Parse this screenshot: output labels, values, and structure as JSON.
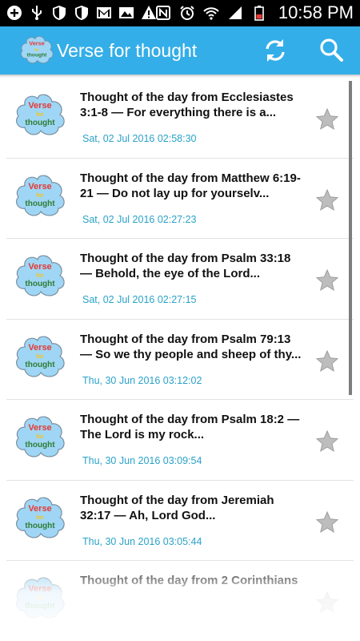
{
  "status_bar": {
    "time": "10:58 PM",
    "left_icons": [
      "add-icon",
      "usb-icon",
      "shield-icon",
      "shield-icon",
      "gmail-icon",
      "image-icon",
      "warning-icon"
    ],
    "right_icons": [
      "nfc-icon",
      "alarm-icon",
      "wifi-icon",
      "signal-icon",
      "battery-icon"
    ]
  },
  "app_bar": {
    "title": "Verse for thought",
    "logo_text": [
      "Verse",
      "for",
      "thought"
    ]
  },
  "items": [
    {
      "title": "Thought of the day from Ecclesiastes 3:1-8 — For everything there is a...",
      "date": "Sat, 02 Jul 2016 02:58:30"
    },
    {
      "title": "Thought of the day from Matthew 6:19-21 — Do not lay up for yourselv...",
      "date": "Sat, 02 Jul 2016 02:27:23"
    },
    {
      "title": "Thought of the day from Psalm 33:18 — Behold, the eye of the Lord...",
      "date": "Sat, 02 Jul 2016 02:27:15"
    },
    {
      "title": "Thought of the day from Psalm 79:13 — So we thy people and sheep of thy...",
      "date": "Thu, 30 Jun 2016 03:12:02"
    },
    {
      "title": "Thought of the day from Psalm 18:2 — The Lord is my rock...",
      "date": "Thu, 30 Jun 2016 03:09:54"
    },
    {
      "title": "Thought of the day from Jeremiah 32:17 — Ah, Lord God...",
      "date": "Thu, 30 Jun 2016 03:05:44"
    },
    {
      "title": "Thought of the day from 2 Corinthians",
      "date": ""
    }
  ],
  "colors": {
    "app_bar": "#33aee8",
    "date": "#2aa2c8",
    "star": "#bdbdbd"
  }
}
